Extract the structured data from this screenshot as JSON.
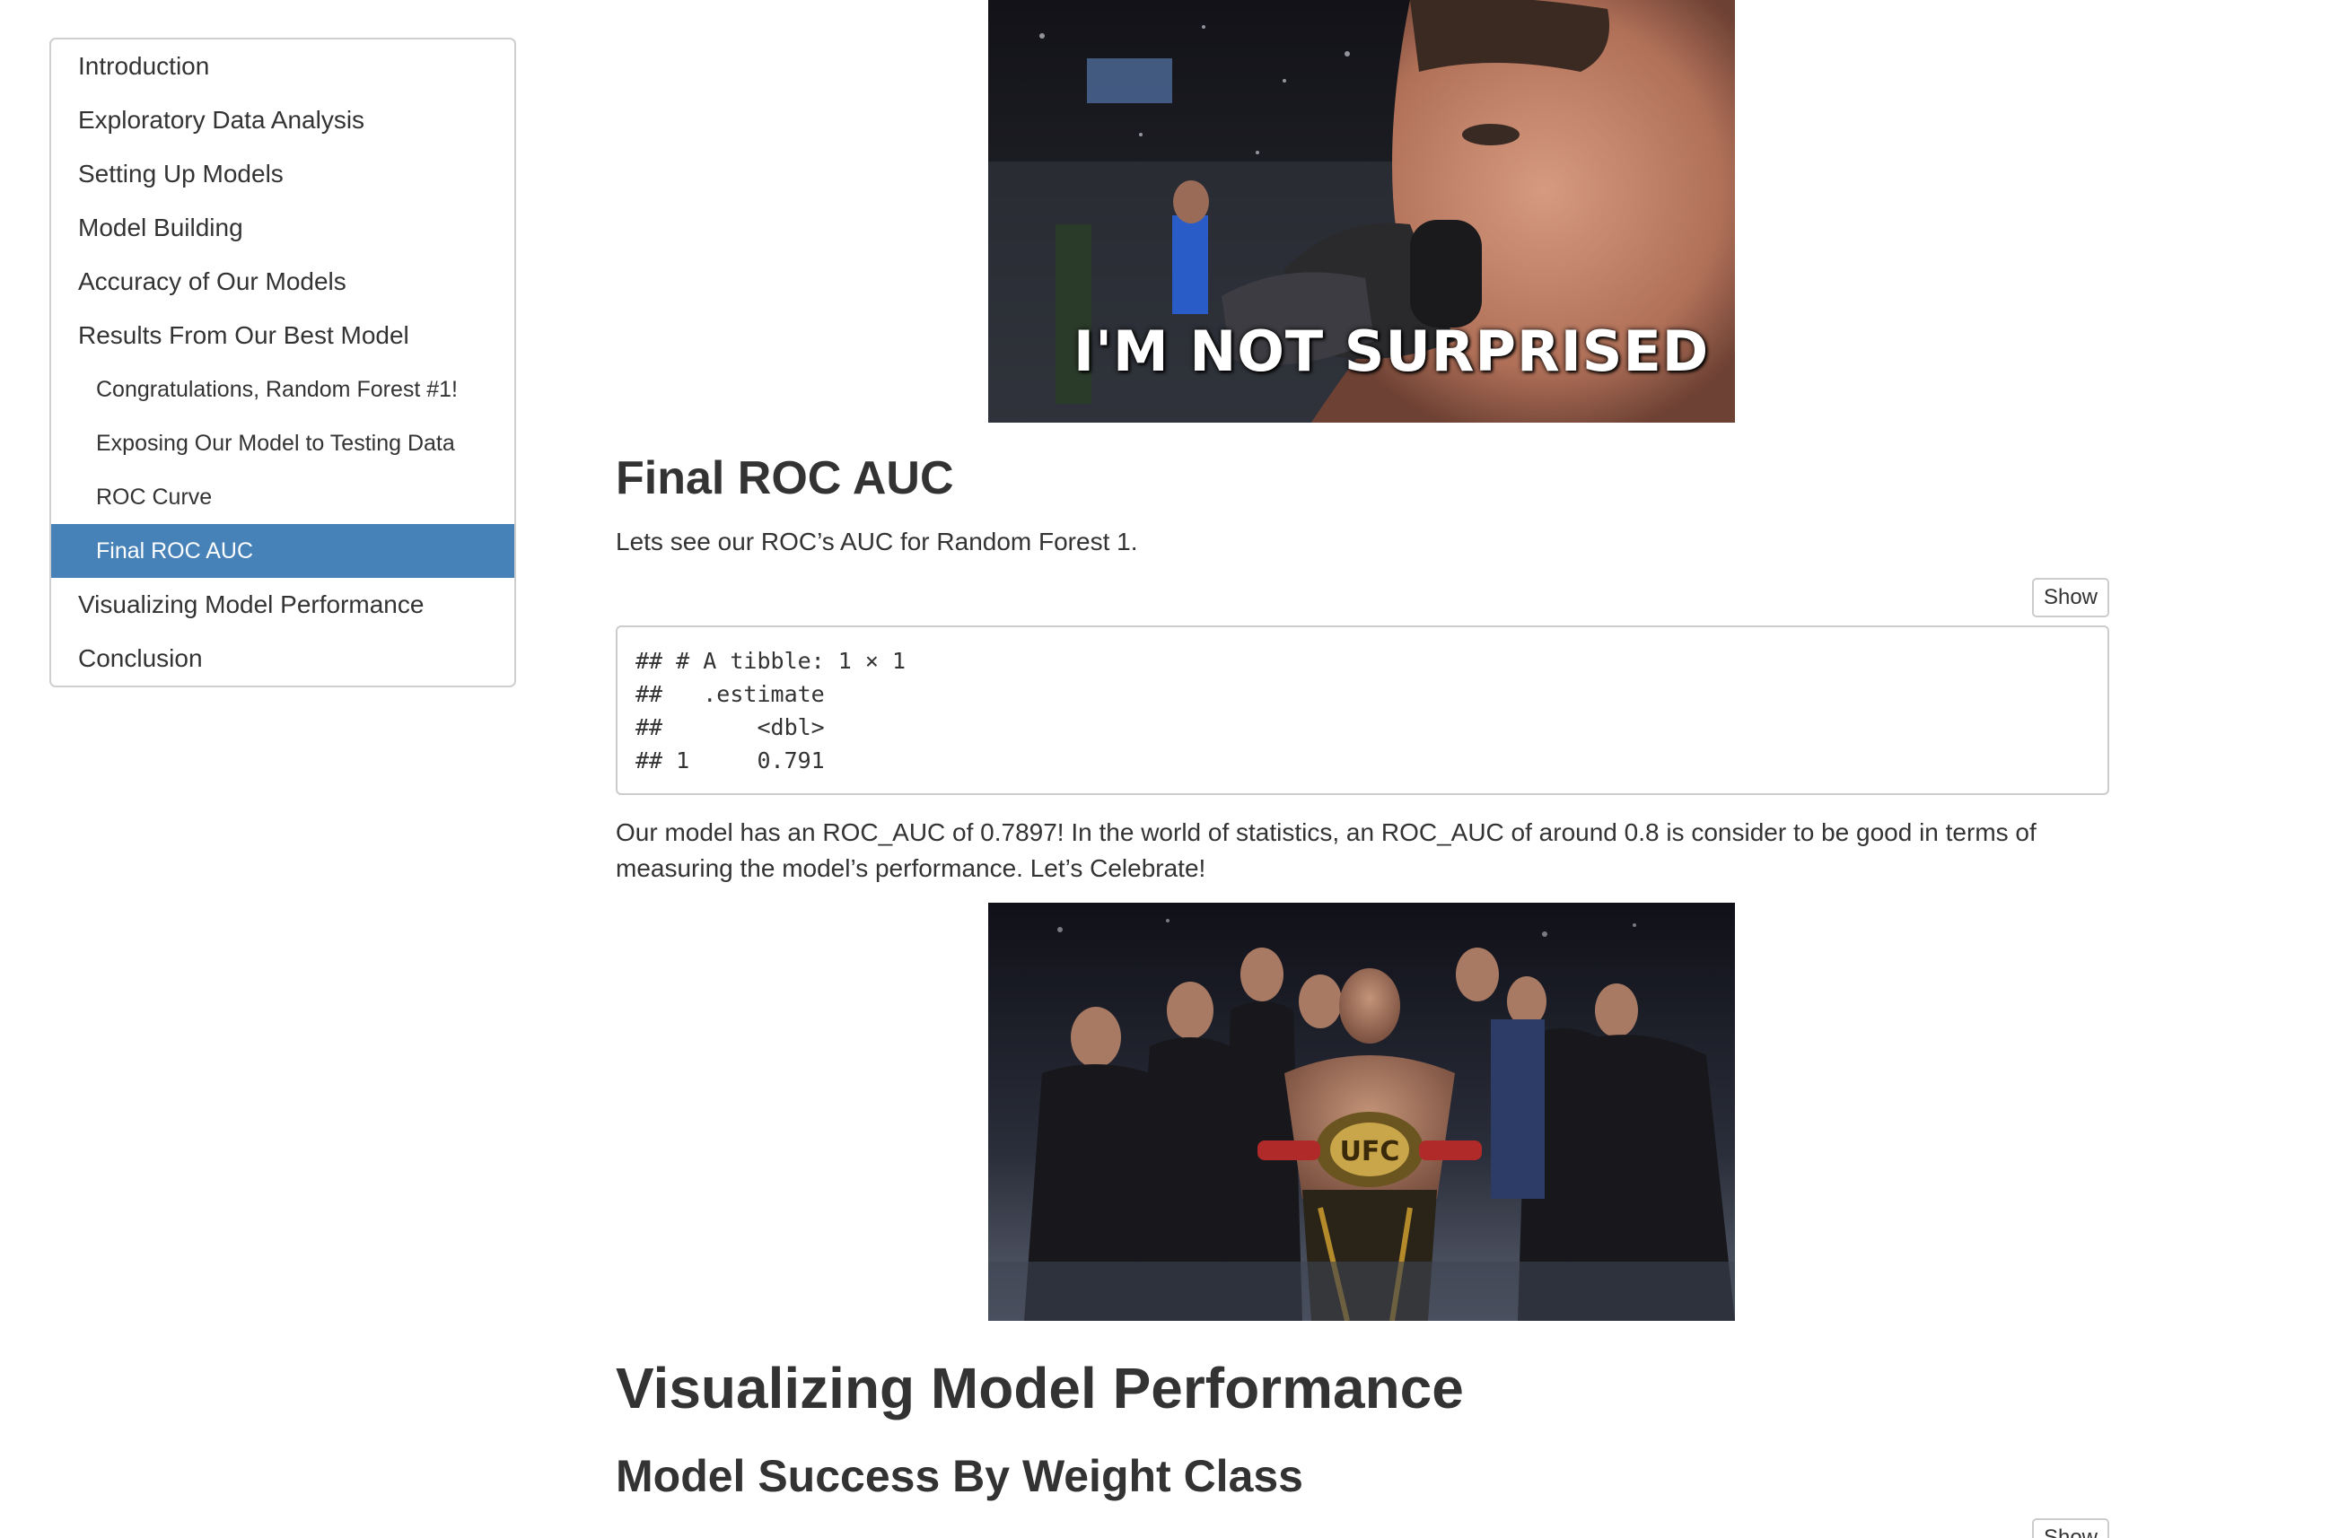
{
  "toc": {
    "items": [
      {
        "label": "Introduction",
        "level": 1,
        "active": false
      },
      {
        "label": "Exploratory Data Analysis",
        "level": 1,
        "active": false
      },
      {
        "label": "Setting Up Models",
        "level": 1,
        "active": false
      },
      {
        "label": "Model Building",
        "level": 1,
        "active": false
      },
      {
        "label": "Accuracy of Our Models",
        "level": 1,
        "active": false
      },
      {
        "label": "Results From Our Best Model",
        "level": 1,
        "active": false
      },
      {
        "label": "Congratulations, Random Forest #1!",
        "level": 2,
        "active": false
      },
      {
        "label": "Exposing Our Model to Testing Data",
        "level": 2,
        "active": false
      },
      {
        "label": "ROC Curve",
        "level": 2,
        "active": false
      },
      {
        "label": "Final ROC AUC",
        "level": 2,
        "active": true
      },
      {
        "label": "Visualizing Model Performance",
        "level": 1,
        "active": false
      },
      {
        "label": "Conclusion",
        "level": 1,
        "active": false
      }
    ],
    "active_color": "#4682b8"
  },
  "gif1": {
    "caption": "I'M NOT SURPRISED"
  },
  "section": {
    "title": "Final ROC AUC",
    "lead": "Lets see our ROC’s AUC for Random Forest 1.",
    "show_label": "Show",
    "output_lines": [
      "## # A tibble: 1 × 1",
      "##   .estimate",
      "##       <dbl>",
      "## 1     0.791"
    ],
    "body": "Our model has an ROC_AUC of 0.7897! In the world of statistics, an ROC_AUC of around 0.8 is consider to be good in terms of measuring the model’s performance. Let’s Celebrate!"
  },
  "gif2": {
    "belt_text": "UFC"
  },
  "next": {
    "title": "Visualizing Model Performance",
    "subtitle": "Model Success By Weight Class",
    "show_label": "Show"
  }
}
